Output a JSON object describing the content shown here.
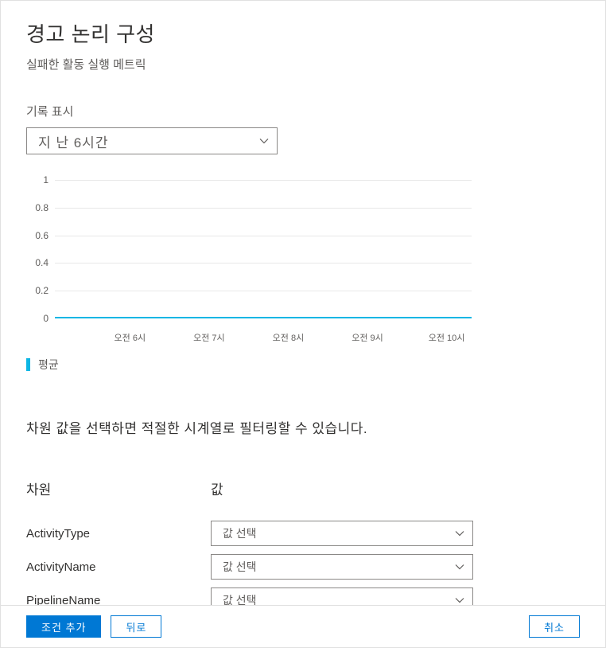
{
  "title": "경고 논리 구성",
  "subtitle": "실패한 활동 실행 메트릭",
  "history": {
    "label": "기록 표시",
    "selected": "지 난 6시간"
  },
  "chart_data": {
    "type": "line",
    "title": "",
    "xlabel": "",
    "ylabel": "",
    "ylim": [
      0,
      1.0
    ],
    "y_ticks": [
      0,
      0.2,
      0.4,
      0.6,
      0.8,
      1.0
    ],
    "categories": [
      "오전 6시",
      "오전 7시",
      "오전 8시",
      "오전 9시",
      "오전 10시"
    ],
    "series": [
      {
        "name": "평균",
        "values": [
          0,
          0,
          0,
          0,
          0
        ],
        "color": "#0cb6e4"
      }
    ]
  },
  "help_text": "차원 값을 선택하면 적절한 시계열로 필터링할 수 있습니다.",
  "dimensions": {
    "col_name": "차원",
    "col_value": "값",
    "placeholder": "값 선택",
    "rows": [
      "ActivityType",
      "ActivityName",
      "PipelineName"
    ]
  },
  "footer": {
    "add": "조건 추가",
    "back": "뒤로",
    "cancel": "취소"
  }
}
